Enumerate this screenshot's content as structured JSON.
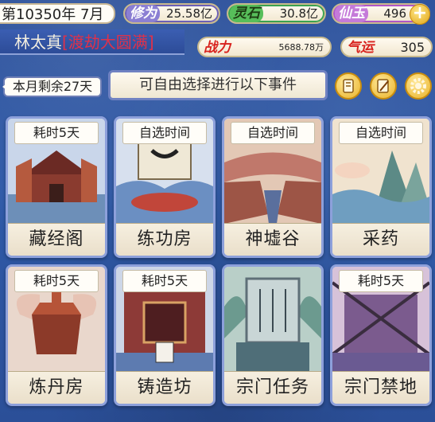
{
  "topbar": {
    "date": "第10350年 7月",
    "resources": [
      {
        "label": "修为",
        "value": "25.58亿"
      },
      {
        "label": "灵石",
        "value": "30.8亿"
      },
      {
        "label": "仙玉",
        "value": "496"
      }
    ],
    "plus_symbol": "+"
  },
  "player": {
    "name": "林太真",
    "realm_open": "[",
    "realm": "渡劫大圆满",
    "realm_close": "]"
  },
  "stats": {
    "zhanli_label": "战力",
    "zhanli_value": "5688.78万",
    "qiyun_label": "气运",
    "qiyun_value": "305"
  },
  "month_remaining": "本月剩余27天",
  "notice": "可自由选择进行以下事件",
  "colors": {
    "accent_blue": "#2f5aa8",
    "frame": "#8da0db",
    "realm_red": "#e0314a",
    "gold": "#e9b228"
  },
  "events": [
    {
      "badge": "耗时5天",
      "title": "藏经阁"
    },
    {
      "badge": "自选时间",
      "title": "练功房"
    },
    {
      "badge": "自选时间",
      "title": "神墟谷"
    },
    {
      "badge": "自选时间",
      "title": "采药"
    },
    {
      "badge": "耗时5天",
      "title": "炼丹房"
    },
    {
      "badge": "耗时5天",
      "title": "铸造坊"
    },
    {
      "badge": "",
      "title": "宗门任务"
    },
    {
      "badge": "耗时5天",
      "title": "宗门禁地"
    }
  ]
}
